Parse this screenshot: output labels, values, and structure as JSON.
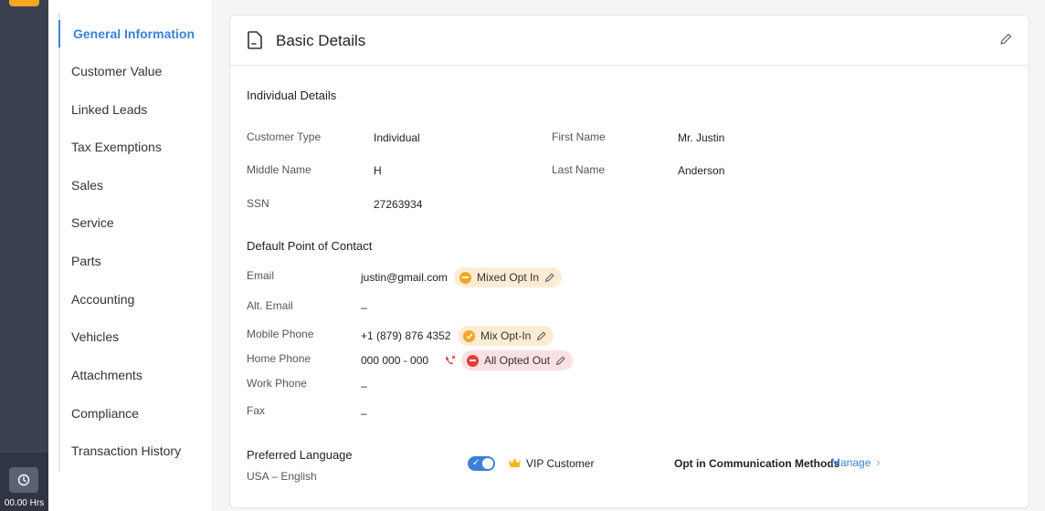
{
  "rail": {
    "timer_text": "00.00 Hrs",
    "timer_icon": "clock-icon",
    "accent_color": "#f5a623"
  },
  "nav": {
    "items": [
      {
        "label": "General Information",
        "active": true
      },
      {
        "label": "Customer Value"
      },
      {
        "label": "Linked Leads"
      },
      {
        "label": "Tax Exemptions"
      },
      {
        "label": "Sales"
      },
      {
        "label": "Service"
      },
      {
        "label": "Parts"
      },
      {
        "label": "Accounting"
      },
      {
        "label": "Vehicles"
      },
      {
        "label": "Attachments"
      },
      {
        "label": "Compliance"
      },
      {
        "label": "Transaction History"
      }
    ]
  },
  "card": {
    "title": "Basic Details",
    "individual": {
      "heading": "Individual Details",
      "customer_type_label": "Customer Type",
      "customer_type": "Individual",
      "first_name_label": "First Name",
      "first_name": "Mr. Justin",
      "middle_name_label": "Middle Name",
      "middle_name": "H",
      "last_name_label": "Last Name",
      "last_name": "Anderson",
      "ssn_label": "SSN",
      "ssn": "27263934"
    },
    "contact": {
      "heading": "Default Point of Contact",
      "email_label": "Email",
      "email": "justin@gmail.com",
      "email_status": "Mixed Opt In",
      "alt_email_label": "Alt. Email",
      "alt_email": "–",
      "mobile_label": "Mobile Phone",
      "mobile": "+1 (879) 876 4352",
      "mobile_status": "Mix Opt-In",
      "home_label": "Home Phone",
      "home": "000 000 - 000",
      "home_status": "All Opted Out",
      "work_label": "Work Phone",
      "work": "–",
      "fax_label": "Fax",
      "fax": "–"
    },
    "preferences": {
      "language_heading": "Preferred Language",
      "language": "USA – English",
      "vip_label": "VIP Customer",
      "vip_enabled": true,
      "opt_in_label": "Opt in Communication Methods",
      "manage_label": "Manage"
    }
  },
  "colors": {
    "primary": "#3b82d6",
    "mixed": "#f5a623",
    "opted_out": "#e03c3c"
  }
}
